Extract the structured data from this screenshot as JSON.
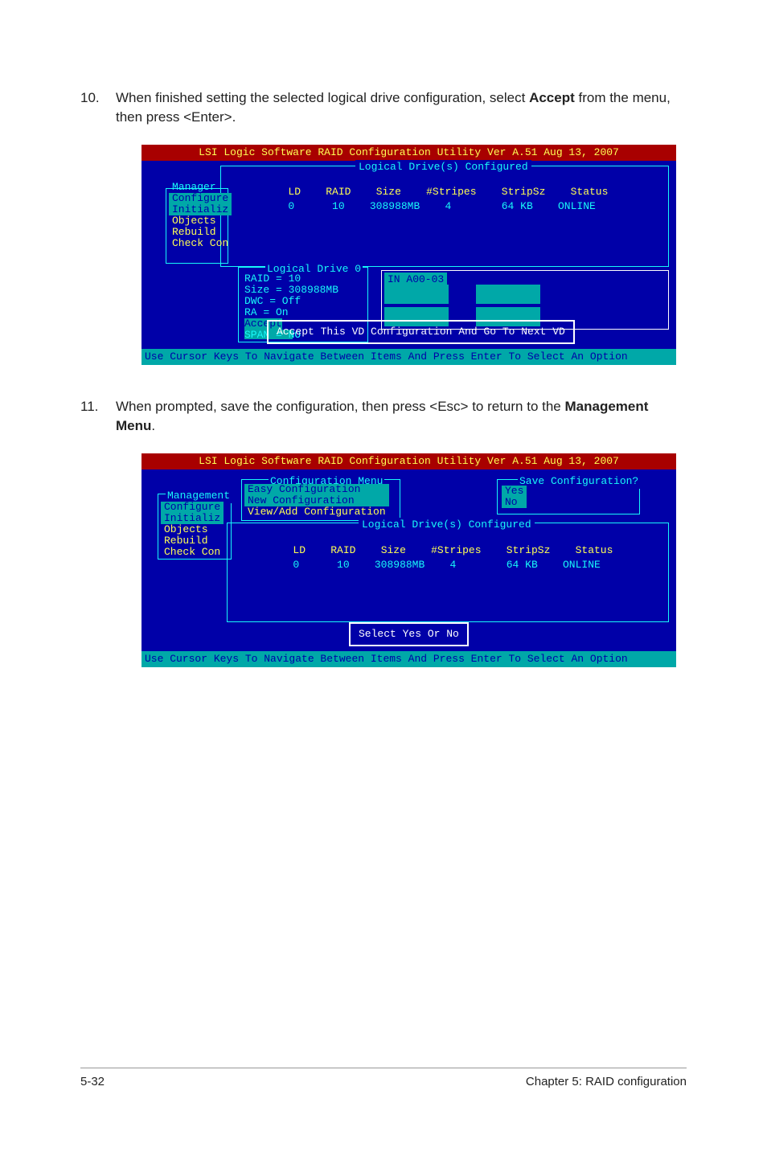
{
  "step10": {
    "num": "10.",
    "text_pre": "When finished setting the selected logical drive configuration, select ",
    "bold": "Accept",
    "text_post": " from the menu, then press <Enter>."
  },
  "step11": {
    "num": "11.",
    "text_pre": "When prompted, save the configuration, then press <Esc> to return to the ",
    "bold": "Management Menu",
    "text_post": "."
  },
  "bios1": {
    "title": "LSI Logic Software RAID Configuration Utility Ver A.51 Aug 13, 2007",
    "panel_title": "Logical Drive(s) Configured",
    "headers": {
      "ld": "LD",
      "raid": "RAID",
      "size": "Size",
      "stripes": "#Stripes",
      "stripsz": "StripSz",
      "status": "Status"
    },
    "row": {
      "ld": "0",
      "raid": "10",
      "size": "308988MB",
      "stripes": "4",
      "stripsz": "64 KB",
      "status": "ONLINE"
    },
    "menu": [
      "Manager",
      "Configure",
      "Initializ",
      "Objects",
      "Rebuild",
      "Check Con"
    ],
    "ld0_title": "Logical Drive 0",
    "ld0_params": [
      "RAID = 10",
      "Size = 308988MB",
      "DWC  = Off",
      "RA   = On",
      "Accept",
      "SPAN = NO"
    ],
    "slot": "IN A00-03",
    "hint": "Accept This VD Configuration And Go To Next VD",
    "footer": "Use Cursor Keys To Navigate Between Items And Press Enter To Select An Option"
  },
  "bios2": {
    "title": "LSI Logic Software RAID Configuration Utility Ver A.51 Aug 13, 2007",
    "mgmt_label": "Management",
    "mgmt_menu": [
      "Configure",
      "Initializ",
      "Objects",
      "Rebuild",
      "Check Con"
    ],
    "cfg_title": "Configuration Menu",
    "cfg_menu": [
      "Easy Configuration",
      "New Configuration",
      "View/Add Configuration"
    ],
    "save_title": "Save Configuration?",
    "save_opts": [
      "Yes",
      "No"
    ],
    "panel_title": "Logical Drive(s) Configured",
    "headers": {
      "ld": "LD",
      "raid": "RAID",
      "size": "Size",
      "stripes": "#Stripes",
      "stripsz": "StripSz",
      "status": "Status"
    },
    "row": {
      "ld": "0",
      "raid": "10",
      "size": "308988MB",
      "stripes": "4",
      "stripsz": "64 KB",
      "status": "ONLINE"
    },
    "hint": "Select Yes Or No",
    "footer": "Use Cursor Keys To Navigate Between Items And Press Enter To Select An Option"
  },
  "page_footer": {
    "left": "5-32",
    "right": "Chapter 5: RAID configuration"
  }
}
